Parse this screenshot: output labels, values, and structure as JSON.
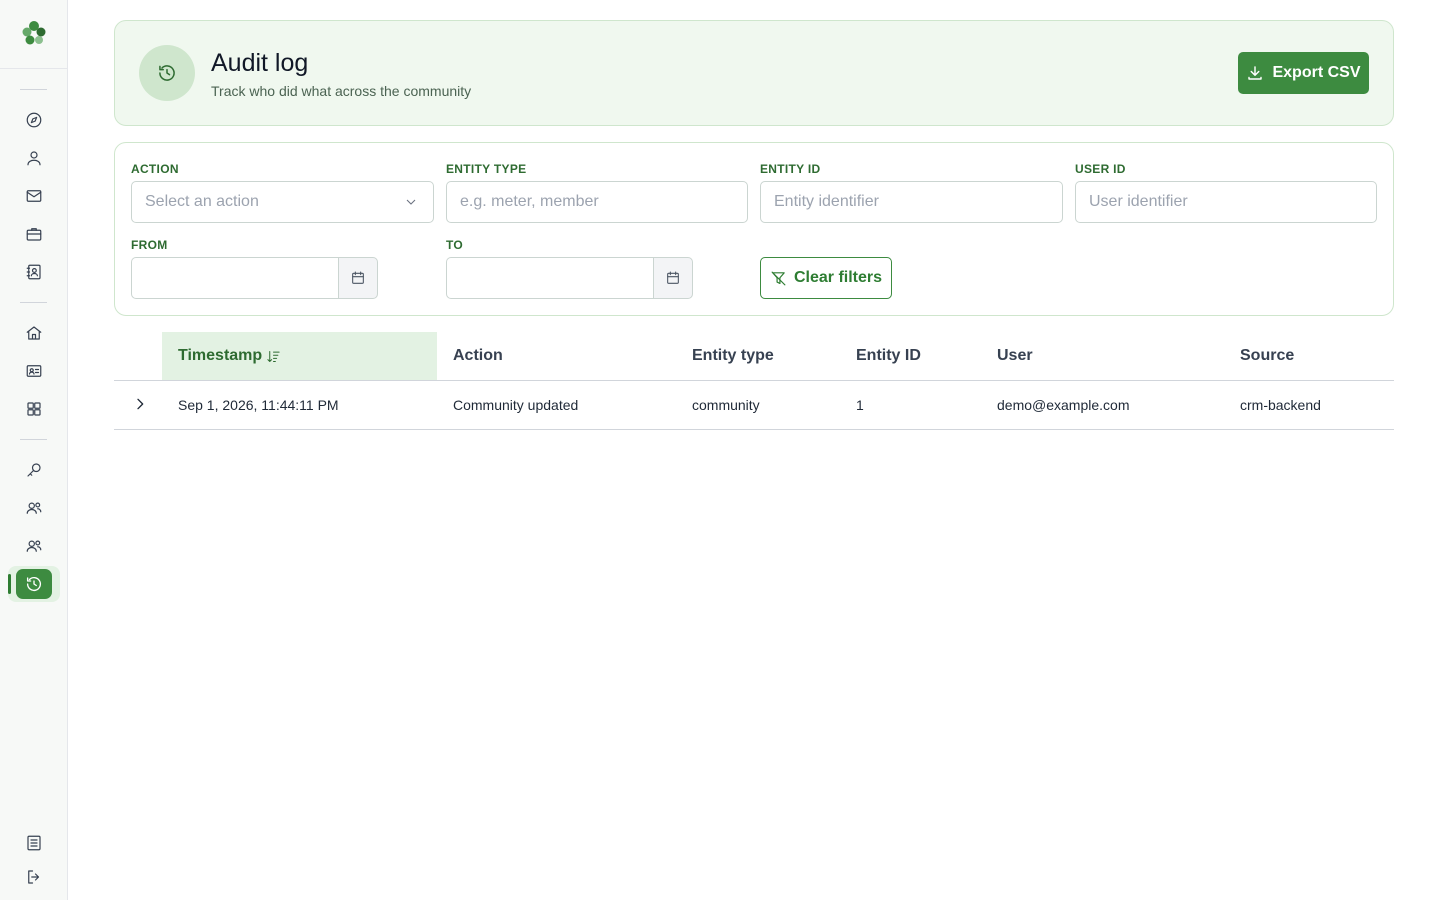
{
  "app": {
    "logo_icon": "clover-logo-icon",
    "accent_color": "#3d8b40"
  },
  "sidebar": {
    "items": [
      {
        "icon": "compass-icon",
        "name": "explore"
      },
      {
        "icon": "user-icon",
        "name": "profile"
      },
      {
        "icon": "mail-icon",
        "name": "messages"
      },
      {
        "icon": "briefcase-icon",
        "name": "business"
      },
      {
        "icon": "contacts-icon",
        "name": "contacts"
      },
      {
        "icon": "home-icon",
        "name": "home"
      },
      {
        "icon": "id-card-icon",
        "name": "members"
      },
      {
        "icon": "grid-icon",
        "name": "apps"
      },
      {
        "icon": "key-icon",
        "name": "access"
      },
      {
        "icon": "users-icon",
        "name": "users"
      },
      {
        "icon": "group-icon",
        "name": "groups"
      },
      {
        "icon": "history-icon",
        "name": "audit-log",
        "active": true
      }
    ],
    "bottom": [
      {
        "icon": "document-icon",
        "name": "docs"
      },
      {
        "icon": "logout-icon",
        "name": "logout"
      }
    ]
  },
  "header": {
    "title": "Audit log",
    "subtitle": "Track who did what across the community",
    "icon": "history-icon",
    "export_label": "Export CSV"
  },
  "filters": {
    "action": {
      "label": "ACTION",
      "placeholder": "Select an action"
    },
    "entity_type": {
      "label": "ENTITY TYPE",
      "placeholder": "e.g. meter, member"
    },
    "entity_id": {
      "label": "ENTITY ID",
      "placeholder": "Entity identifier"
    },
    "user_id": {
      "label": "USER ID",
      "placeholder": "User identifier"
    },
    "from": {
      "label": "FROM",
      "value": ""
    },
    "to": {
      "label": "TO",
      "value": ""
    },
    "clear_label": "Clear filters"
  },
  "table": {
    "columns": [
      "Timestamp",
      "Action",
      "Entity type",
      "Entity ID",
      "User",
      "Source"
    ],
    "sorted_column": "Timestamp",
    "rows": [
      {
        "timestamp": "Sep 1, 2026, 11:44:11 PM",
        "action": "Community updated",
        "entity_type": "community",
        "entity_id": "1",
        "user": "demo@example.com",
        "source": "crm-backend"
      }
    ]
  }
}
